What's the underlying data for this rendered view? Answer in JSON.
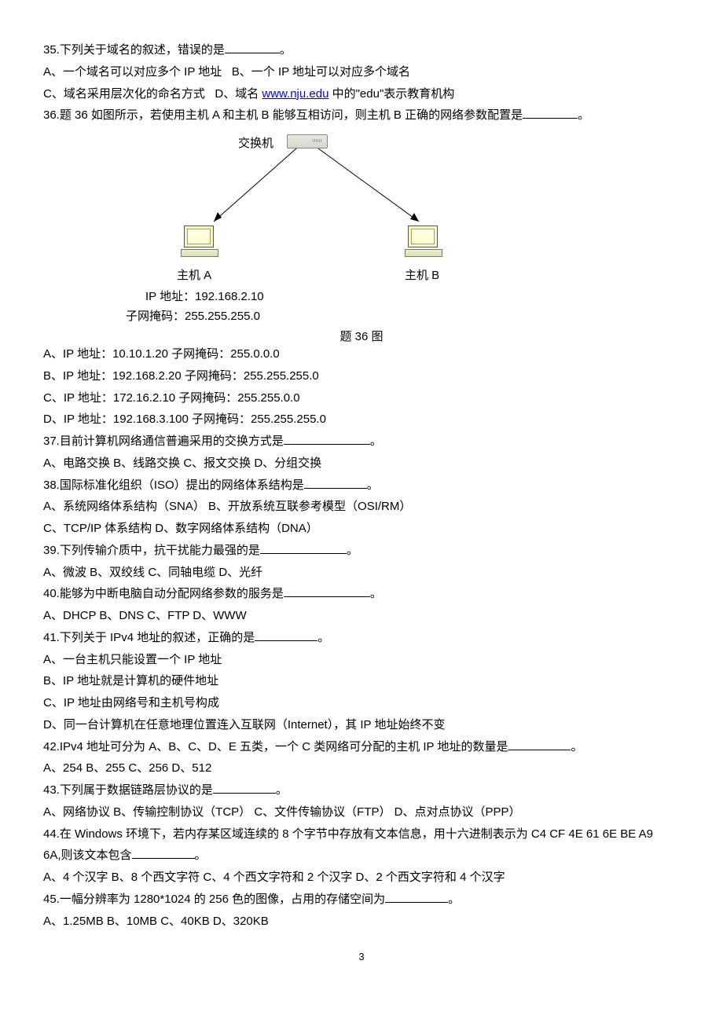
{
  "q35": {
    "stem_a": "35.下列关于域名的叙述，错误的是",
    "stem_b": "。",
    "optA": "A、一个域名可以对应多个 IP 地址",
    "optB": "B、一个 IP 地址可以对应多个域名",
    "optC_a": "C、域名采用层次化的命名方式",
    "optD_a": "D、域名 ",
    "link": "www.nju.edu",
    "optD_b": " 中的\"edu\"表示教育机构"
  },
  "q36": {
    "stem_a": "36.题 36 如图所示，若使用主机 A 和主机 B 能够互相访问，则主机 B 正确的网络参数配置是",
    "stem_b": "。",
    "switch_label": "交换机",
    "hostA_label": "主机 A",
    "hostB_label": "主机 B",
    "hostA_ip": "IP 地址：192.168.2.10",
    "hostA_mask": "子网掩码：255.255.255.0",
    "caption": "题 36 图",
    "optA": "A、IP 地址：10.10.1.20   子网掩码：255.0.0.0",
    "optB": "B、IP 地址：192.168.2.20   子网掩码：255.255.255.0",
    "optC": "C、IP 地址：172.16.2.10   子网掩码：255.255.0.0",
    "optD": "D、IP 地址：192.168.3.100   子网掩码：255.255.255.0"
  },
  "q37": {
    "stem_a": "37.目前计算机网络通信普遍采用的交换方式是",
    "stem_b": "。",
    "opts": "A、电路交换   B、线路交换   C、报文交换   D、分组交换"
  },
  "q38": {
    "stem_a": "38.国际标准化组织（ISO）提出的网络体系结构是",
    "stem_b": "。",
    "line1": "A、系统网络体系结构（SNA）   B、开放系统互联参考模型（OSI/RM）",
    "line2": "C、TCP/IP 体系结构   D、数字网络体系结构（DNA）"
  },
  "q39": {
    "stem_a": "39.下列传输介质中，抗干扰能力最强的是",
    "stem_b": "。",
    "opts": "A、微波   B、双绞线   C、同轴电缆   D、光纤"
  },
  "q40": {
    "stem_a": "40.能够为中断电脑自动分配网络参数的服务是",
    "stem_b": "。",
    "opts": "A、DHCP   B、DNS   C、FTP     D、WWW"
  },
  "q41": {
    "stem_a": "41.下列关于 IPv4 地址的叙述，正确的是",
    "stem_b": "。",
    "optA": "A、一台主机只能设置一个 IP 地址",
    "optB": "B、IP 地址就是计算机的硬件地址",
    "optC": "C、IP 地址由网络号和主机号构成",
    "optD": "D、同一台计算机在任意地理位置连入互联网（Internet），其 IP 地址始终不变"
  },
  "q42": {
    "stem_a": "42.IPv4 地址可分为 A、B、C、D、E 五类，一个 C 类网络可分配的主机 IP 地址的数量是",
    "stem_b": "。",
    "opts": "A、254   B、255   C、256   D、512"
  },
  "q43": {
    "stem_a": "43.下列属于数据链路层协议的是",
    "stem_b": "。",
    "opts": "A、网络协议   B、传输控制协议（TCP）   C、文件传输协议（FTP）   D、点对点协议（PPP）"
  },
  "q44": {
    "line1": "44.在 Windows 环境下，若内存某区域连续的 8 个字节中存放有文本信息，用十六进制表示为 C4 CF 4E 61 6E BE A9",
    "line2_a": "6A,则该文本包含",
    "line2_b": "。",
    "opts": "A、4 个汉字   B、8 个西文字符   C、4 个西文字符和 2 个汉字   D、2 个西文字符和 4 个汉字"
  },
  "q45": {
    "stem_a": "45.一幅分辨率为 1280*1024 的 256 色的图像，占用的存储空间为",
    "stem_b": "。",
    "opts": "A、1.25MB   B、10MB   C、40KB   D、320KB"
  },
  "pagenum": "3"
}
